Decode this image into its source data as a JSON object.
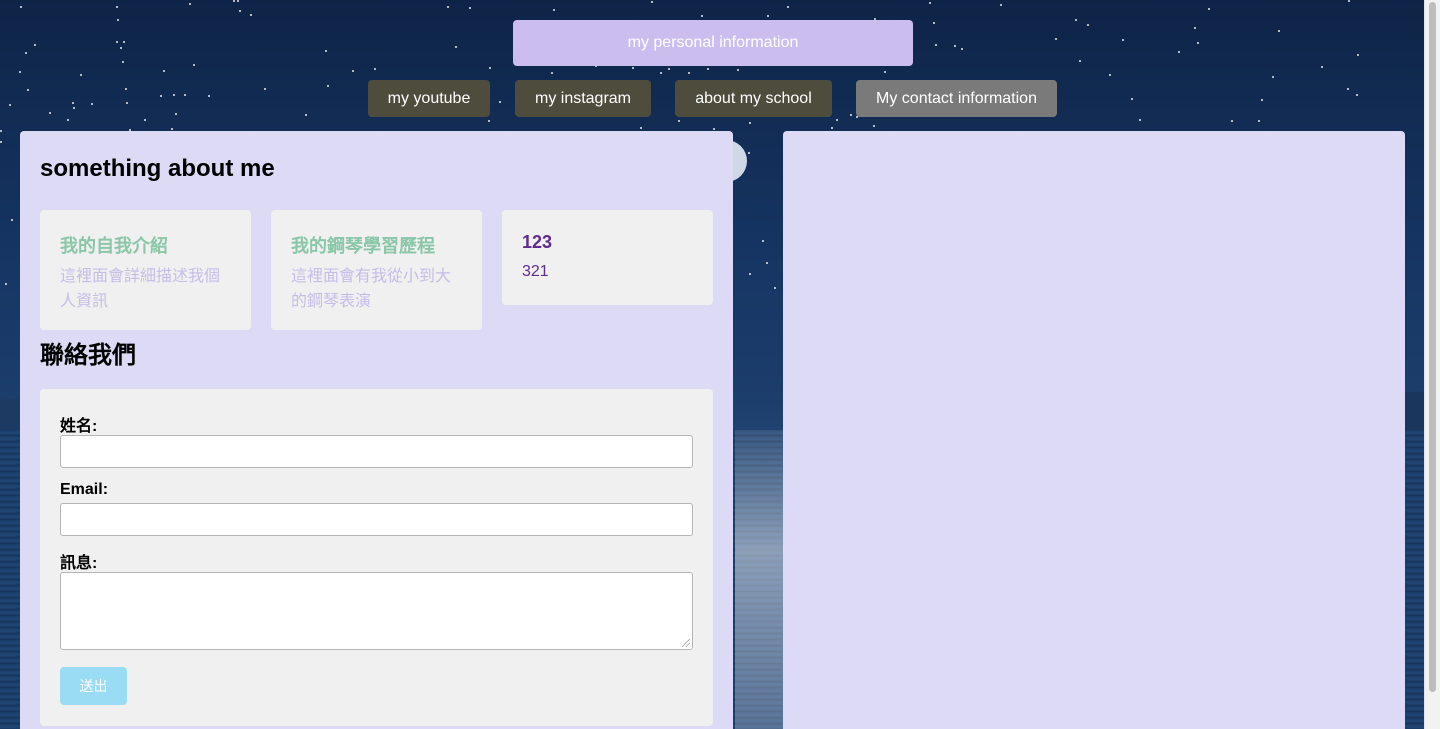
{
  "header": {
    "title_button": "my personal information"
  },
  "nav": {
    "items": [
      {
        "label": "my youtube"
      },
      {
        "label": "my instagram"
      },
      {
        "label": "about my school"
      },
      {
        "label": "My contact information"
      }
    ]
  },
  "about": {
    "title": "something about me",
    "cards": [
      {
        "heading": "我的自我介紹",
        "text": "這裡面會詳細描述我個人資訊"
      },
      {
        "heading": "我的鋼琴學習歷程",
        "text": "這裡面會有我從小到大的鋼琴表演"
      },
      {
        "heading": "123",
        "text": "321"
      }
    ]
  },
  "contact": {
    "title": "聯絡我們",
    "name_label": "姓名:",
    "name_value": "",
    "email_label": "Email:",
    "email_value": "",
    "message_label": "訊息:",
    "message_value": "",
    "submit_label": "送出"
  },
  "colors": {
    "panel_bg": "#dcdaf5",
    "header_button": "#cbbdee",
    "nav_button": "#4e4c3d",
    "nav_button_active": "#7a7a7a",
    "card_heading_green": "#8ac6a8",
    "card_text_lavender": "#c6bde7",
    "card_purple": "#5e2b8f",
    "submit_button": "#99dcf4"
  }
}
